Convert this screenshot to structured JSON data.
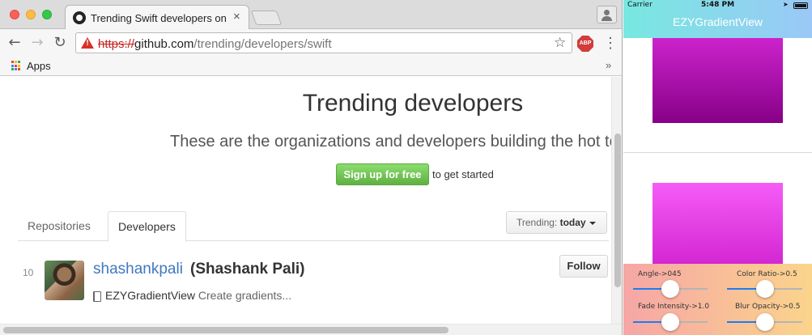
{
  "browser": {
    "tab_title": "Trending Swift developers on GitHub",
    "tab_close_glyph": "×",
    "url_scheme": "https://",
    "url_host": "github.com",
    "url_path": "/trending/developers/swift",
    "warn_glyph": "!",
    "star_glyph": "☆",
    "abp_label": "ABP",
    "menu_glyph": "⋮",
    "back_glyph": "←",
    "forward_glyph": "→",
    "reload_glyph": "↻",
    "bookmarks": {
      "apps_label": "Apps",
      "more_glyph": "»"
    },
    "apps_icon_colors": [
      "#ea4335",
      "#fbbc05",
      "#34a853",
      "#4285f4",
      "#ea4335",
      "#fbbc05",
      "#34a853",
      "#4285f4",
      "#ea4335"
    ]
  },
  "page": {
    "title": "Trending developers",
    "subtitle": "These are the organizations and developers building the hot tools",
    "signup_label": "Sign up for free",
    "signup_tail": "to get started",
    "tabs": [
      {
        "label": "Repositories",
        "selected": false
      },
      {
        "label": "Developers",
        "selected": true
      }
    ],
    "trending_label": "Trending:",
    "trending_value": "today",
    "developers": [
      {
        "rank": "10",
        "login": "shashankpali",
        "name": "(Shashank Pali)",
        "repo": "EZYGradientView",
        "description": "Create gradients...",
        "follow_label": "Follow"
      }
    ],
    "colors": {
      "link": "#4078c0",
      "signup_green": "#60b044"
    }
  },
  "simulator": {
    "carrier": "Carrier",
    "time": "5:48 PM",
    "app_title": "EZYGradientView",
    "colors": {
      "header_start": "#77e8e0",
      "header_end": "#9bc8f7",
      "box1_top": "#cc23cc",
      "box1_bottom": "#870087",
      "box2_top": "#f65cf6",
      "box2_bottom": "#d327d3",
      "slider_fill": "#1e7cf2"
    },
    "sliders": [
      {
        "label": "Angle->045",
        "value": 0.5
      },
      {
        "label": "Color Ratio->0.5",
        "value": 0.5
      },
      {
        "label": "Fade Intensity->1.0",
        "value": 0.5
      },
      {
        "label": "Blur Opacity->0.5",
        "value": 0.5
      }
    ]
  }
}
